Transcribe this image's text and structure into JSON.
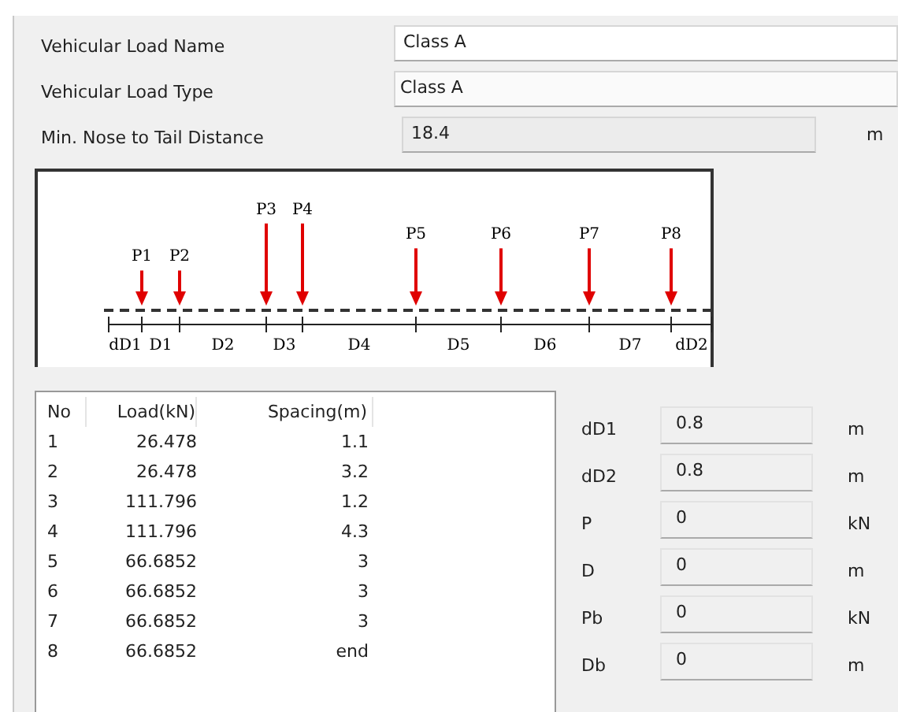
{
  "form": [
    {
      "label": "Vehicular Load Name",
      "value": "Class A",
      "kind": "text"
    },
    {
      "label": "Vehicular Load Type",
      "value": "Class A",
      "kind": "select"
    },
    {
      "label": "Min. Nose to Tail Distance",
      "value": "18.4",
      "kind": "readonly",
      "unit": "m"
    }
  ],
  "diagram": {
    "loads": [
      "P1",
      "P2",
      "P3",
      "P4",
      "P5",
      "P6",
      "P7",
      "P8"
    ],
    "spacings": [
      "dD1",
      "D1",
      "D2",
      "D3",
      "D4",
      "D5",
      "D6",
      "D7",
      "dD2"
    ]
  },
  "table": {
    "columns": [
      "No",
      "Load(kN)",
      "Spacing(m)"
    ],
    "rows": [
      [
        "1",
        "26.478",
        "1.1"
      ],
      [
        "2",
        "26.478",
        "3.2"
      ],
      [
        "3",
        "111.796",
        "1.2"
      ],
      [
        "4",
        "111.796",
        "4.3"
      ],
      [
        "5",
        "66.6852",
        "3"
      ],
      [
        "6",
        "66.6852",
        "3"
      ],
      [
        "7",
        "66.6852",
        "3"
      ],
      [
        "8",
        "66.6852",
        "end"
      ]
    ]
  },
  "params": [
    {
      "label": "dD1",
      "value": "0.8",
      "unit": "m"
    },
    {
      "label": "dD2",
      "value": "0.8",
      "unit": "m"
    },
    {
      "label": "P",
      "value": "0",
      "unit": "kN"
    },
    {
      "label": "D",
      "value": "0",
      "unit": "m"
    },
    {
      "label": "Pb",
      "value": "0",
      "unit": "kN"
    },
    {
      "label": "Db",
      "value": "0",
      "unit": "m"
    }
  ]
}
